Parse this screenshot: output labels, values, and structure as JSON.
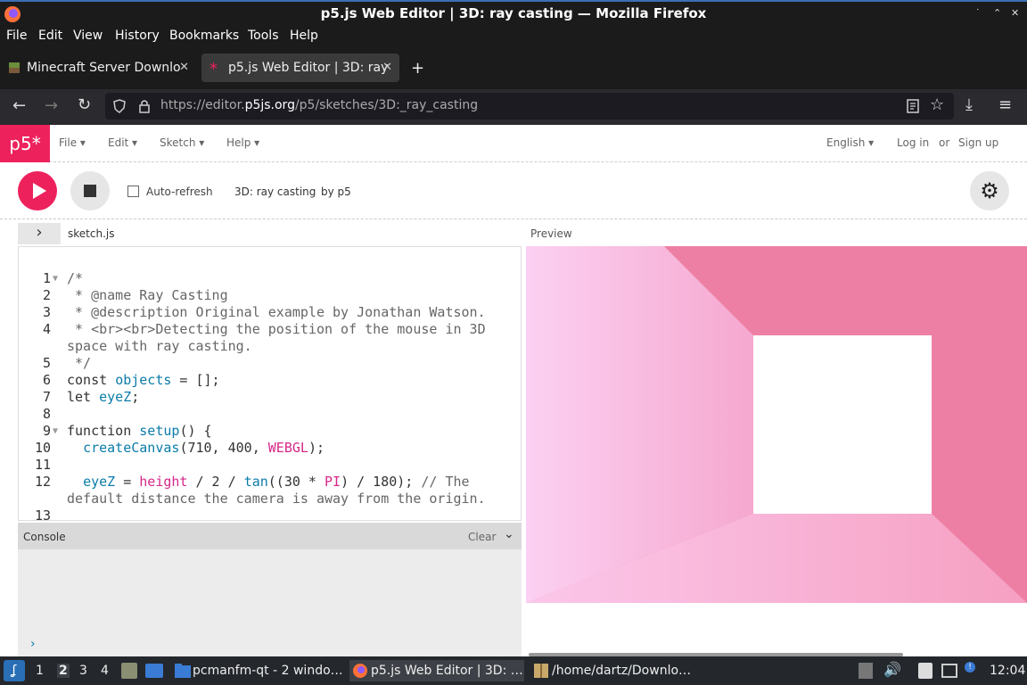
{
  "window": {
    "title": "p5.js Web Editor | 3D: ray casting — Mozilla Firefox",
    "controls": [
      "˙",
      "⌃",
      "✕"
    ]
  },
  "menubar": [
    "File",
    "Edit",
    "View",
    "History",
    "Bookmarks",
    "Tools",
    "Help"
  ],
  "tabs": [
    {
      "label": "Minecraft Server Downlo",
      "icon": "minecraft-icon",
      "active": false
    },
    {
      "label": "p5.js Web Editor | 3D: ray",
      "icon": "p5-asterisk-icon",
      "active": true
    }
  ],
  "new_tab_label": "+",
  "url": {
    "prefix": "https://editor.",
    "domain": "p5js.org",
    "path": "/p5/sketches/3D:_ray_casting"
  },
  "p5": {
    "logo": "p5*",
    "menus": [
      "File ▾",
      "Edit ▾",
      "Sketch ▾",
      "Help ▾"
    ],
    "language": "English ▾",
    "login": "Log in",
    "or": "or",
    "signup": "Sign up",
    "accent": "#ed225d"
  },
  "toolbar": {
    "auto_refresh": "Auto-refresh",
    "sketch_name": "3D: ray casting",
    "by": "by p5"
  },
  "editor": {
    "filename": "sketch.js",
    "preview_label": "Preview",
    "lines": [
      {
        "n": "1",
        "fold": "▼",
        "html": "<span class='cm'>/*</span>"
      },
      {
        "n": "2",
        "fold": "",
        "html": "<span class='cm'> * @name Ray Casting</span>"
      },
      {
        "n": "3",
        "fold": "",
        "html": "<span class='cm'> * @description Original example by Jonathan Watson.</span>"
      },
      {
        "n": "4",
        "fold": "",
        "html": "<span class='cm'> * &lt;br&gt;&lt;br&gt;Detecting the position of the mouse in 3D</span>"
      },
      {
        "n": "",
        "fold": "",
        "html": "<span class='cm'>space with ray casting.</span>"
      },
      {
        "n": "5",
        "fold": "",
        "html": "<span class='cm'> */</span>"
      },
      {
        "n": "6",
        "fold": "",
        "html": "const <span class='vr'>objects</span> = [];"
      },
      {
        "n": "7",
        "fold": "",
        "html": "let <span class='vr'>eyeZ</span>;"
      },
      {
        "n": "8",
        "fold": "",
        "html": ""
      },
      {
        "n": "9",
        "fold": "▼",
        "html": "function <span class='fn'>setup</span>() {"
      },
      {
        "n": "10",
        "fold": "",
        "html": "  <span class='fn'>createCanvas</span>(710, 400, <span class='pk'>WEBGL</span>);"
      },
      {
        "n": "11",
        "fold": "",
        "html": ""
      },
      {
        "n": "12",
        "fold": "",
        "html": "  <span class='vr'>eyeZ</span> = <span class='pk'>height</span> / 2 / <span class='fn'>tan</span>((30 * <span class='pk'>PI</span>) / 180); <span class='cm'>// The</span>"
      },
      {
        "n": "",
        "fold": "",
        "html": "<span class='cm'>default distance the camera is away from the origin.</span>"
      },
      {
        "n": "13",
        "fold": "",
        "html": ""
      }
    ]
  },
  "console": {
    "label": "Console",
    "clear": "Clear",
    "prompt": "›"
  },
  "taskbar": {
    "workspaces": [
      "1",
      "2",
      "3",
      "4"
    ],
    "tasks": [
      {
        "label": "pcmanfm-qt - 2 windo…",
        "icon": "folder-icon",
        "active": false
      },
      {
        "label": "p5.js Web Editor | 3D: …",
        "icon": "firefox-icon",
        "active": true
      },
      {
        "label": "/home/dartz/Downlo…",
        "icon": "archive-icon",
        "active": false
      }
    ],
    "clock": "12:04"
  }
}
